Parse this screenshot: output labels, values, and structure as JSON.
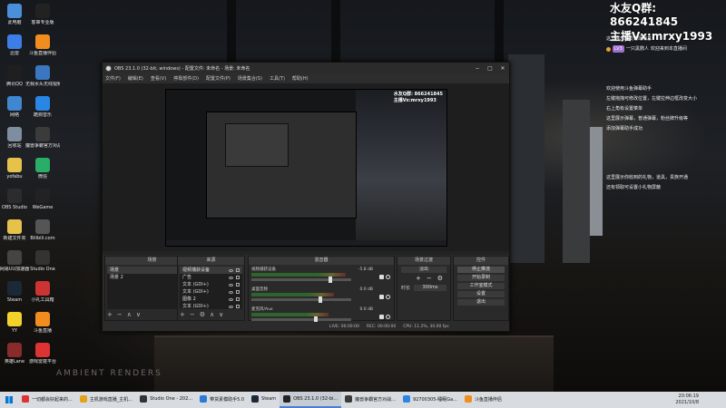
{
  "colors": {
    "accent": "#4a7fd0",
    "obs_bg": "#2b2b2b",
    "meter_green": "#2f6b2f",
    "taskbar": "#d8dce0"
  },
  "desktop": {
    "icons_left": [
      {
        "label": "此电脑",
        "icon": "computer-icon",
        "color": "#4a8fd8"
      },
      {
        "label": "迅雷",
        "icon": "xunlei-icon",
        "color": "#3c7ee6"
      },
      {
        "label": "腾讯QQ",
        "icon": "qq-icon",
        "color": "#1f1f1f"
      },
      {
        "label": "网络",
        "icon": "network-icon",
        "color": "#3f87d0"
      },
      {
        "label": "回收站",
        "icon": "recycle-bin-icon",
        "color": "#7e8ea0"
      },
      {
        "label": "yofabu",
        "icon": "folder-icon",
        "color": "#e6c24a"
      },
      {
        "label": "OBS Studio",
        "icon": "obs-icon",
        "color": "#2c2c2c"
      },
      {
        "label": "新建文件夹",
        "icon": "folder-icon",
        "color": "#e6c24a"
      },
      {
        "label": "网易UU加速器",
        "icon": "uu-icon",
        "color": "#444"
      },
      {
        "label": "Steam",
        "icon": "steam-icon",
        "color": "#1b2838"
      },
      {
        "label": "YY",
        "icon": "yy-icon",
        "color": "#f3d32b"
      },
      {
        "label": "英雄Lane",
        "icon": "game-icon",
        "color": "#8a2b2b"
      }
    ],
    "icons_right": [
      {
        "label": "客串专业版",
        "icon": "capcut-icon",
        "color": "#222"
      },
      {
        "label": "斗鱼直播伴侣",
        "icon": "douyu-icon",
        "color": "#f18d1f"
      },
      {
        "label": "无我水头无线视频",
        "icon": "wireless-icon",
        "color": "#3a77c0"
      },
      {
        "label": "酷狗音乐",
        "icon": "kugou-icon",
        "color": "#2a86e4"
      },
      {
        "label": "魔兽争霸官方对战平台",
        "icon": "warcraft-icon",
        "color": "#3b3b3b"
      },
      {
        "label": "微信",
        "icon": "wechat-icon",
        "color": "#2aae67"
      },
      {
        "label": "WeGame",
        "icon": "wegame-icon",
        "color": "#222"
      },
      {
        "label": "Bilibili.com",
        "icon": "bilibili-icon",
        "color": "#555"
      },
      {
        "label": "Studio One",
        "icon": "studio-one-icon",
        "color": "#333"
      },
      {
        "label": "小礼工具箱",
        "icon": "gift-tool-icon",
        "color": "#c33"
      },
      {
        "label": "斗鱼直播",
        "icon": "douyu-live-icon",
        "color": "#f18d1f"
      },
      {
        "label": "游戏雷霆平台",
        "icon": "game-platform-icon",
        "color": "#d33"
      }
    ],
    "bed_text": "AMBIENT RENDERS"
  },
  "overlay": {
    "qq_group": "水友Q群: 866241845",
    "anchor": "主播Vx:mrxy1993",
    "chat": [
      {
        "text": "这里展示水友进场消息"
      },
      {
        "user": "一只黑鹦人",
        "level": "LV3",
        "text": "欢迎来到本直播间"
      },
      {
        "text": "欢迎使用斗鱼弹幕助手"
      },
      {
        "text": "左键拖拽可修改位置，左键拉伸边框改变大小"
      },
      {
        "text": "右上角有设置菜单"
      },
      {
        "text": "这里展示弹幕，普通弹幕，粉丝牌升级等"
      },
      {
        "text": "添加弹幕助手成功"
      },
      {
        "text": "这里展示你收到的礼物，道具，贵族开通"
      },
      {
        "text": "还有领取可设置小礼物屏蔽"
      }
    ]
  },
  "obs": {
    "title": "OBS 23.1.0 (32-bit, windows) - 配置文件: 未命名 - 场景: 未命名",
    "menu": [
      "文件(F)",
      "编辑(E)",
      "查看(V)",
      "停靠部件(D)",
      "配置文件(P)",
      "场景集合(S)",
      "工具(T)",
      "帮助(H)"
    ],
    "nested_overlay": [
      "水友Q群: 866241845",
      "主播Vx:mrxy1993"
    ],
    "docks": {
      "scenes": {
        "title": "场景",
        "items": [
          "场景",
          "场景 2"
        ]
      },
      "sources": {
        "title": "来源",
        "items": [
          "视频捕获设备",
          "广告",
          "文本 (GDI+)",
          "文本 (GDI+)",
          "图像 2",
          "文本 (GDI+)",
          "文本 (GDI+)",
          "图像"
        ]
      },
      "mixer": {
        "title": "混音器",
        "channels": [
          {
            "name": "视频捕获设备",
            "db": "-5.8 dB",
            "level": 0.8
          },
          {
            "name": "桌面音频",
            "db": "0.0 dB",
            "level": 0.7
          },
          {
            "name": "麦克风/Aux",
            "db": "0.0 dB",
            "level": 0.65
          }
        ]
      },
      "transitions": {
        "title": "场景过渡",
        "type": "淡出",
        "duration_label": "时长",
        "duration": "300ms"
      },
      "controls": {
        "title": "控件",
        "buttons": [
          "停止推流",
          "开始录制",
          "工作室模式",
          "设置",
          "退出"
        ]
      }
    },
    "status": {
      "live": "LIVE: 00:00:00",
      "rec": "REC: 00:00:00",
      "cpu": "CPU: 11.2%, 30.00 fps"
    }
  },
  "taskbar": {
    "items": [
      {
        "label": "一切都会好起来的...",
        "icon": "netease-icon",
        "color": "#d33",
        "active": false
      },
      {
        "label": "主机游戏直播_主机...",
        "icon": "chrome-icon",
        "color": "#e3a21a",
        "active": false
      },
      {
        "label": "Studio One - 202...",
        "icon": "studio-one-icon",
        "color": "#333",
        "active": false
      },
      {
        "label": "带货素模助手5.0",
        "icon": "helper-icon",
        "color": "#2a7bd6",
        "active": false
      },
      {
        "label": "Steam",
        "icon": "steam-icon",
        "color": "#1b2838",
        "active": false
      },
      {
        "label": "OBS 23.1.0 (32-bi...",
        "icon": "obs-icon",
        "color": "#222",
        "active": true
      },
      {
        "label": "魔兽争霸官方对战...",
        "icon": "warcraft-icon",
        "color": "#3b3b3b",
        "active": false
      },
      {
        "label": "92700305-睡眠Ga...",
        "icon": "qq-icon",
        "color": "#2a86e4",
        "active": false
      },
      {
        "label": "斗鱼直播伴侣",
        "icon": "douyu-icon",
        "color": "#f18d1f",
        "active": false
      }
    ],
    "time": "20:06:19",
    "date": "2021/10/8"
  }
}
